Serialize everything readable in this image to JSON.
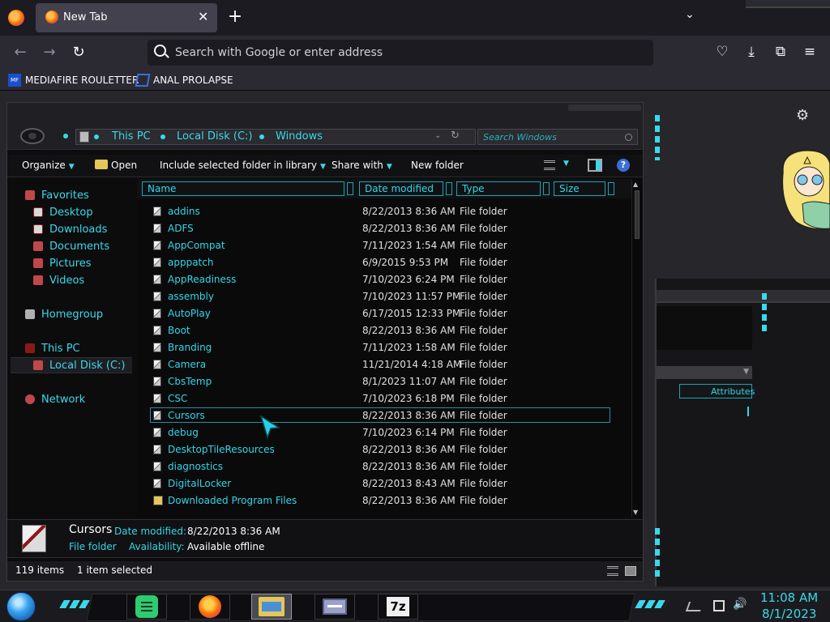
{
  "browser": {
    "tab_title": "New Tab",
    "tab_close": "✕",
    "new_tab": "+",
    "tab_list": "⌄",
    "back": "←",
    "forward": "→",
    "reload": "↻",
    "url_placeholder": "Search with Google or enter address",
    "pocket": "♡",
    "downloads": "⤓",
    "extensions": "⧉",
    "menu": "≡",
    "bookmarks": [
      {
        "label": "MEDIAFIRE ROULETTER",
        "icon": "MF\nT"
      },
      {
        "label": "ANAL PROLAPSE",
        "icon": ""
      }
    ]
  },
  "explorer": {
    "breadcrumbs": [
      "This PC",
      "Local Disk (C:)",
      "Windows"
    ],
    "search_placeholder": "Search Windows",
    "commands": {
      "organize": "Organize",
      "open": "Open",
      "include": "Include selected folder in library",
      "share": "Share with",
      "new_folder": "New folder",
      "dropdown": "▼",
      "help": "?"
    },
    "nav": {
      "favorites": "Favorites",
      "desktop": "Desktop",
      "downloads": "Downloads",
      "documents": "Documents",
      "pictures": "Pictures",
      "videos": "Videos",
      "homegroup": "Homegroup",
      "this_pc": "This PC",
      "local_disk": "Local Disk (C:)",
      "network": "Network"
    },
    "columns": {
      "name": "Name",
      "date": "Date modified",
      "type": "Type",
      "size": "Size"
    },
    "files": [
      {
        "name": "addins",
        "date": "8/22/2013 8:36 AM",
        "type": "File folder"
      },
      {
        "name": "ADFS",
        "date": "8/22/2013 8:36 AM",
        "type": "File folder"
      },
      {
        "name": "AppCompat",
        "date": "7/11/2023 1:54 AM",
        "type": "File folder"
      },
      {
        "name": "apppatch",
        "date": "6/9/2015 9:53 PM",
        "type": "File folder"
      },
      {
        "name": "AppReadiness",
        "date": "7/10/2023 6:24 PM",
        "type": "File folder"
      },
      {
        "name": "assembly",
        "date": "7/10/2023 11:57 PM",
        "type": "File folder"
      },
      {
        "name": "AutoPlay",
        "date": "6/17/2015 12:33 PM",
        "type": "File folder"
      },
      {
        "name": "Boot",
        "date": "8/22/2013 8:36 AM",
        "type": "File folder"
      },
      {
        "name": "Branding",
        "date": "7/11/2023 1:58 AM",
        "type": "File folder"
      },
      {
        "name": "Camera",
        "date": "11/21/2014 4:18 AM",
        "type": "File folder"
      },
      {
        "name": "CbsTemp",
        "date": "8/1/2023 11:07 AM",
        "type": "File folder"
      },
      {
        "name": "CSC",
        "date": "7/10/2023 6:18 PM",
        "type": "File folder"
      },
      {
        "name": "Cursors",
        "date": "8/22/2013 8:36 AM",
        "type": "File folder"
      },
      {
        "name": "debug",
        "date": "7/10/2023 6:14 PM",
        "type": "File folder"
      },
      {
        "name": "DesktopTileResources",
        "date": "8/22/2013 8:36 AM",
        "type": "File folder"
      },
      {
        "name": "diagnostics",
        "date": "8/22/2013 8:36 AM",
        "type": "File folder"
      },
      {
        "name": "DigitalLocker",
        "date": "8/22/2013 8:43 AM",
        "type": "File folder"
      },
      {
        "name": "Downloaded Program Files",
        "date": "8/22/2013 8:36 AM",
        "type": "File folder"
      }
    ],
    "selected_index": 12,
    "details": {
      "name": "Cursors",
      "date_label": "Date modified:",
      "date_value": "8/22/2013 8:36 AM",
      "type": "File folder",
      "availability_label": "Availability:",
      "availability_value": "Available offline"
    },
    "status": {
      "items": "119 items",
      "selected": "1 item selected"
    }
  },
  "background_window": {
    "attributes_header": "Attributes"
  },
  "taskbar": {
    "seven_zip": "7z",
    "clock_time": "11:08 AM",
    "clock_date": "8/1/2023",
    "volume": "🔊"
  },
  "desktop": {
    "settings": "⚙"
  },
  "colors": {
    "accent_cyan": "#3ad8ea",
    "bg_dark": "#0c0c0d",
    "firefox_bar": "#2b2a33"
  }
}
